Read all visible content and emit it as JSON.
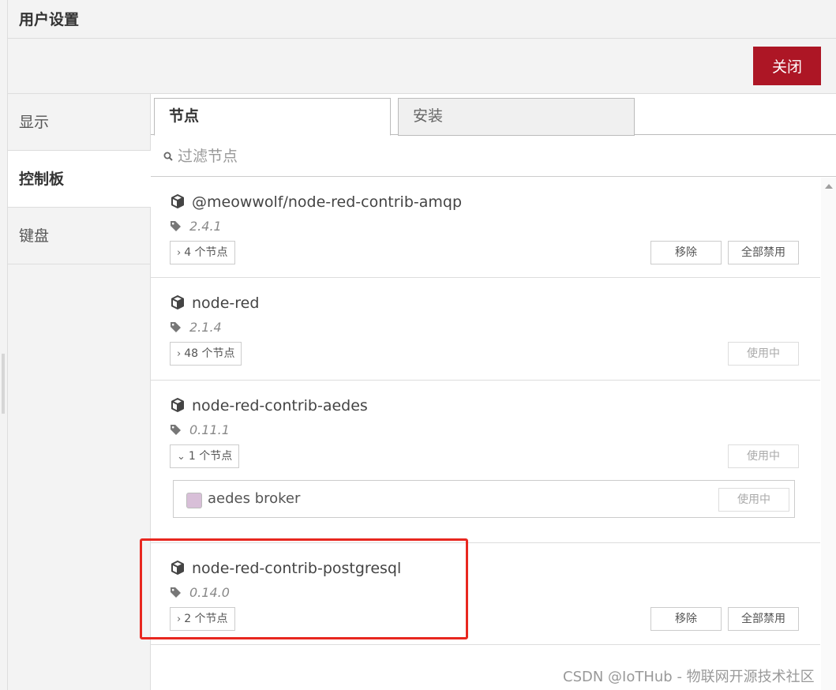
{
  "title": "用户设置",
  "close_label": "关闭",
  "sidebar": {
    "items": [
      {
        "label": "显示"
      },
      {
        "label": "控制板"
      },
      {
        "label": "键盘"
      }
    ]
  },
  "tabs": [
    {
      "label": "节点"
    },
    {
      "label": "安装"
    }
  ],
  "filter": {
    "placeholder": "过滤节点"
  },
  "packages": [
    {
      "name": "@meowwolf/node-red-contrib-amqp",
      "version": "2.4.1",
      "nodes_label": "4 个节点",
      "expanded": false,
      "remove_label": "移除",
      "disable_label": "全部禁用"
    },
    {
      "name": "node-red",
      "version": "2.1.4",
      "nodes_label": "48 个节点",
      "expanded": false,
      "status_label": "使用中"
    },
    {
      "name": "node-red-contrib-aedes",
      "version": "0.11.1",
      "nodes_label": "1 个节点",
      "expanded": true,
      "status_label": "使用中",
      "nodes": [
        {
          "label": "aedes broker",
          "status_label": "使用中",
          "color": "#d8bfd8"
        }
      ]
    },
    {
      "name": "node-red-contrib-postgresql",
      "version": "0.14.0",
      "nodes_label": "2 个节点",
      "expanded": false,
      "remove_label": "移除",
      "disable_label": "全部禁用"
    }
  ],
  "watermark": "CSDN @IoTHub - 物联网开源技术社区",
  "colors": {
    "close_button": "#ad1625",
    "highlight_box": "#e8271f",
    "node_swatch": "#d8bfd8"
  }
}
